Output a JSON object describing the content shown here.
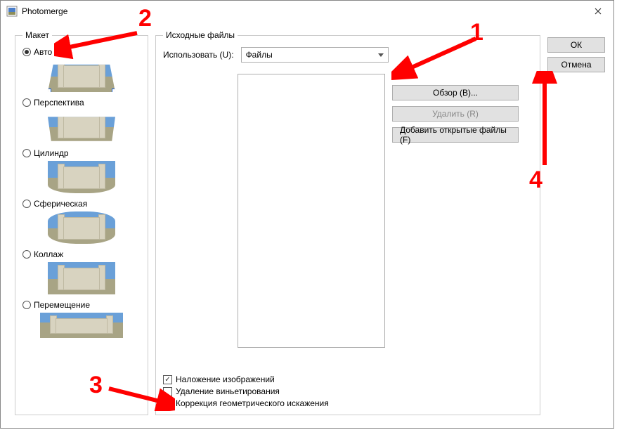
{
  "window": {
    "title": "Photomerge"
  },
  "layout_group": {
    "legend": "Макет",
    "options": {
      "auto": {
        "label": "Авто",
        "selected": true
      },
      "persp": {
        "label": "Перспектива",
        "selected": false
      },
      "cyl": {
        "label": "Цилиндр",
        "selected": false
      },
      "sphere": {
        "label": "Сферическая",
        "selected": false
      },
      "collage": {
        "label": "Коллаж",
        "selected": false
      },
      "repo": {
        "label": "Перемещение",
        "selected": false
      }
    }
  },
  "source_group": {
    "legend": "Исходные файлы",
    "use_label": "Использовать (U):",
    "use_value": "Файлы",
    "browse": "Обзор (B)...",
    "remove": "Удалить (R)",
    "add_open": "Добавить открытые файлы (F)",
    "checks": {
      "blend": {
        "label": "Наложение изображений",
        "checked": true
      },
      "vignette": {
        "label": "Удаление виньетирования",
        "checked": false
      },
      "geom": {
        "label": "Коррекция геометрического искажения",
        "checked": false
      }
    }
  },
  "buttons": {
    "ok": "ОК",
    "cancel": "Отмена"
  },
  "annotations": {
    "n1": "1",
    "n2": "2",
    "n3": "3",
    "n4": "4"
  }
}
